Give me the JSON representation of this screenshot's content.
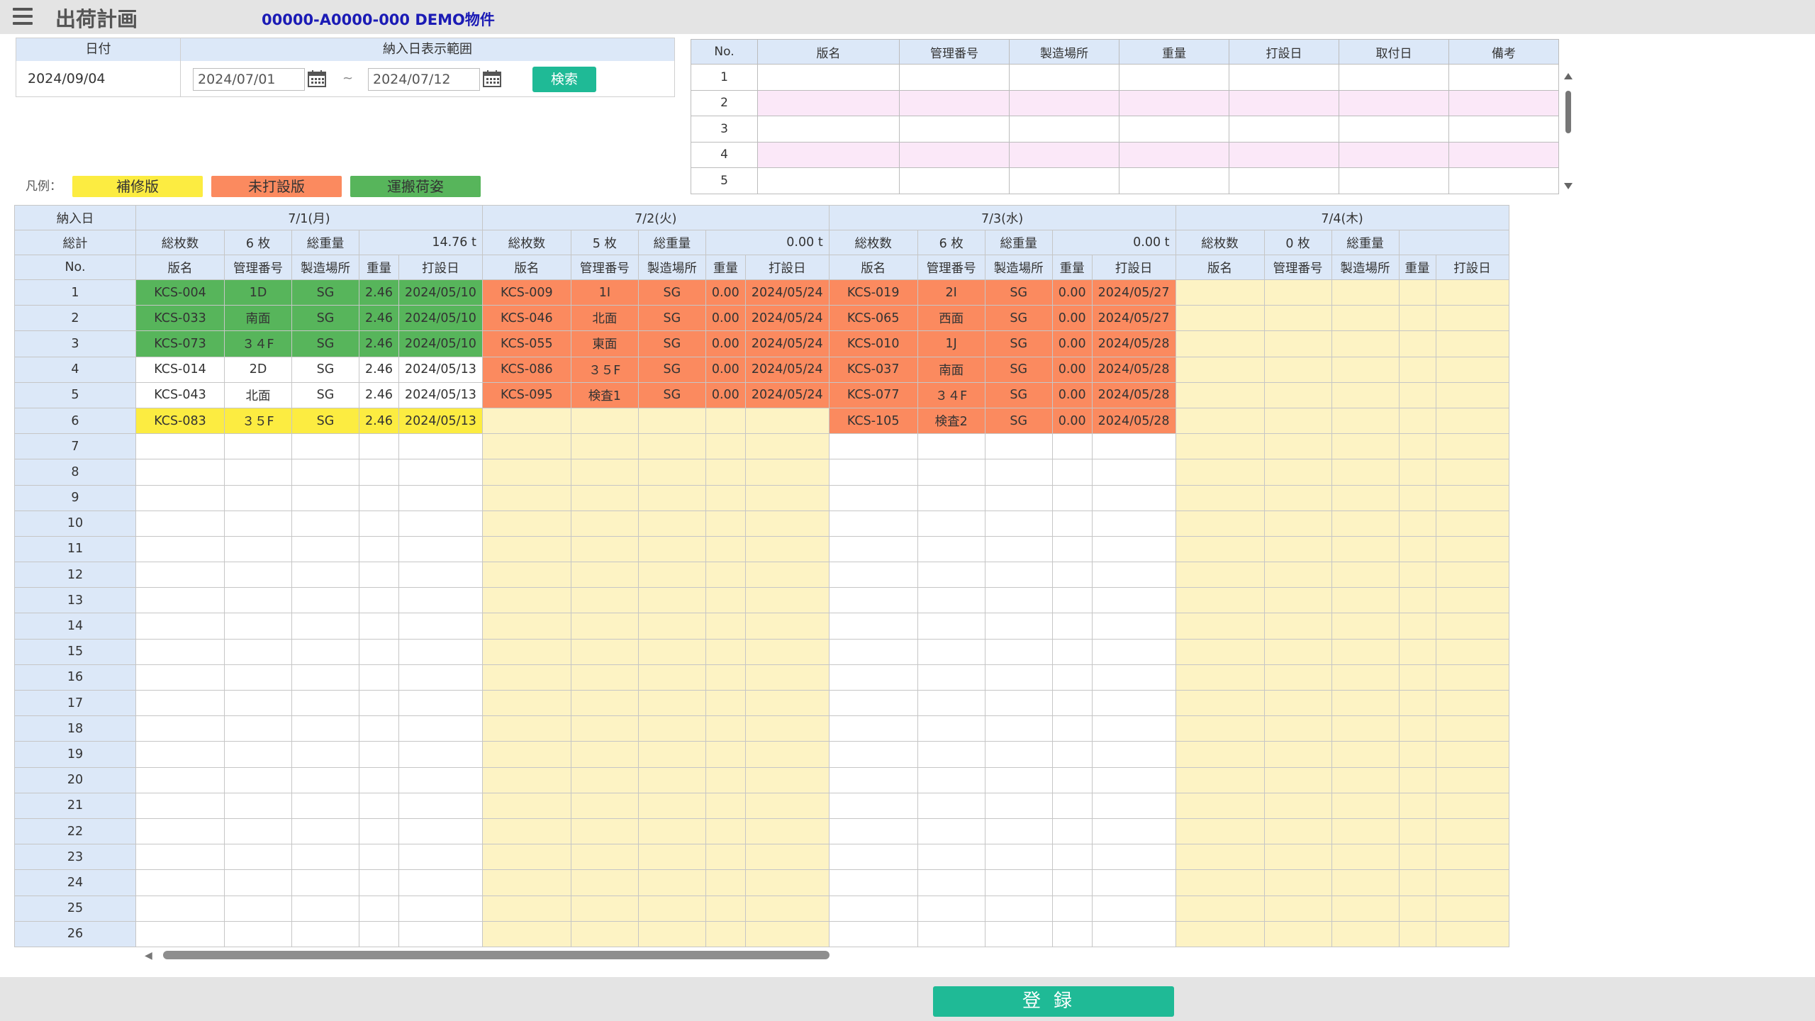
{
  "header": {
    "title": "出荷計画",
    "project": "00000-A0000-000 DEMO物件"
  },
  "conditions": {
    "date_label": "日付",
    "date_value": "2024/09/04",
    "range_label": "納入日表示範囲",
    "range_from": "2024/07/01",
    "range_separator": "~",
    "range_to": "2024/07/12",
    "search_label": "検索"
  },
  "legend": {
    "label": "凡例：",
    "items": [
      {
        "label": "補修版",
        "color": "#fcec41"
      },
      {
        "label": "未打設版",
        "color": "#fb8a5f"
      },
      {
        "label": "運搬荷姿",
        "color": "#57b55b"
      }
    ]
  },
  "detail_table": {
    "headers": [
      "No.",
      "版名",
      "管理番号",
      "製造場所",
      "重量",
      "打設日",
      "取付日",
      "備考"
    ],
    "rows": [
      "1",
      "2",
      "3",
      "4",
      "5"
    ]
  },
  "grid": {
    "row_labels": {
      "delivery": "納入日",
      "total": "総計",
      "no": "No."
    },
    "sub_headers": {
      "count": "総枚数",
      "weight": "総重量"
    },
    "columns": [
      "版名",
      "管理番号",
      "製造場所",
      "重量",
      "打設日"
    ],
    "days": [
      {
        "date": "7/1(月)",
        "count": "6 枚",
        "weight": "14.76 t",
        "rows": [
          [
            "KCS-004",
            "1D",
            "SG",
            "2.46",
            "2024/05/10"
          ],
          [
            "KCS-033",
            "南面",
            "SG",
            "2.46",
            "2024/05/10"
          ],
          [
            "KCS-073",
            "３４F",
            "SG",
            "2.46",
            "2024/05/10"
          ],
          [
            "KCS-014",
            "2D",
            "SG",
            "2.46",
            "2024/05/13"
          ],
          [
            "KCS-043",
            "北面",
            "SG",
            "2.46",
            "2024/05/13"
          ],
          [
            "KCS-083",
            "３５F",
            "SG",
            "2.46",
            "2024/05/13"
          ]
        ]
      },
      {
        "date": "7/2(火)",
        "count": "5 枚",
        "weight": "0.00 t",
        "rows": [
          [
            "KCS-009",
            "1I",
            "SG",
            "0.00",
            "2024/05/24"
          ],
          [
            "KCS-046",
            "北面",
            "SG",
            "0.00",
            "2024/05/24"
          ],
          [
            "KCS-055",
            "東面",
            "SG",
            "0.00",
            "2024/05/24"
          ],
          [
            "KCS-086",
            "３５F",
            "SG",
            "0.00",
            "2024/05/24"
          ],
          [
            "KCS-095",
            "検査1",
            "SG",
            "0.00",
            "2024/05/24"
          ]
        ]
      },
      {
        "date": "7/3(水)",
        "count": "6 枚",
        "weight": "0.00 t",
        "rows": [
          [
            "KCS-019",
            "2I",
            "SG",
            "0.00",
            "2024/05/27"
          ],
          [
            "KCS-065",
            "西面",
            "SG",
            "0.00",
            "2024/05/27"
          ],
          [
            "KCS-010",
            "1J",
            "SG",
            "0.00",
            "2024/05/28"
          ],
          [
            "KCS-037",
            "南面",
            "SG",
            "0.00",
            "2024/05/28"
          ],
          [
            "KCS-077",
            "３４F",
            "SG",
            "0.00",
            "2024/05/28"
          ],
          [
            "KCS-105",
            "検査2",
            "SG",
            "0.00",
            "2024/05/28"
          ]
        ]
      },
      {
        "date": "7/4(木)",
        "count": "0 枚",
        "weight": "",
        "rows": []
      }
    ],
    "row_numbers": [
      "1",
      "2",
      "3",
      "4",
      "5",
      "6",
      "7",
      "8",
      "9",
      "10",
      "11",
      "12",
      "13",
      "14",
      "15",
      "16",
      "17",
      "18",
      "19",
      "20",
      "21",
      "22",
      "23",
      "24",
      "25",
      "26"
    ],
    "row_status": {
      "0": [
        "green",
        "green",
        "green",
        "white",
        "white",
        "yellow"
      ],
      "1": [
        "orange",
        "orange",
        "orange",
        "orange",
        "orange"
      ],
      "2": [
        "orange",
        "orange",
        "orange",
        "orange",
        "orange",
        "orange"
      ]
    },
    "day_backgrounds": [
      "white",
      "cream",
      "white",
      "cream"
    ]
  },
  "footer": {
    "register_label": "登録"
  }
}
